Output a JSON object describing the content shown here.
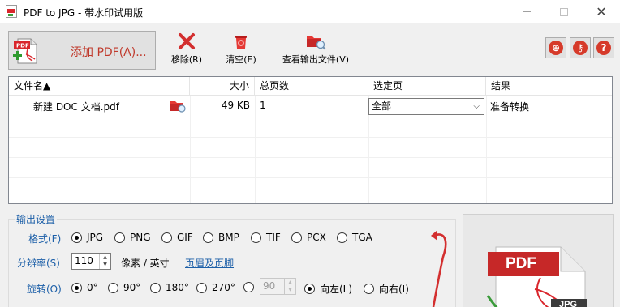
{
  "window": {
    "title": "PDF to JPG - 带水印试用版",
    "close_glyph": "✕"
  },
  "toolbar": {
    "add_pdf_label": "添加 PDF(A)...",
    "remove_label": "移除(R)",
    "clear_label": "清空(E)",
    "view_output_label": "查看输出文件(V)",
    "colors": {
      "accent_red": "#d63a2a",
      "add_label_red": "#c0392b"
    }
  },
  "file_table": {
    "columns": [
      "文件名▲",
      "大小",
      "总页数",
      "选定页",
      "结果"
    ],
    "rows": [
      {
        "name": "新建 DOC 文档.pdf",
        "size": "49 KB",
        "pages": "1",
        "selected_pages": "全部",
        "result": "准备转换"
      }
    ]
  },
  "output_settings": {
    "legend": "输出设置",
    "format_label": "格式(F)",
    "formats": [
      "JPG",
      "PNG",
      "GIF",
      "BMP",
      "TIF",
      "PCX",
      "TGA"
    ],
    "format_selected": "JPG",
    "resolution_label": "分辨率(S)",
    "resolution_value": "110",
    "resolution_unit": "像素 / 英寸",
    "header_footer_link": "页眉及页脚",
    "rotation_label": "旋转(O)",
    "rotations": [
      "0°",
      "90°",
      "180°",
      "270°"
    ],
    "rotation_selected": "0°",
    "custom_rotation_value": "90",
    "direction_left": "向左(L)",
    "direction_right": "向右(I)",
    "direction_selected": "向左(L)",
    "link_color": "#1c5fa8"
  },
  "preview": {
    "badge_pdf": "PDF",
    "badge_jpg": "JPG"
  }
}
